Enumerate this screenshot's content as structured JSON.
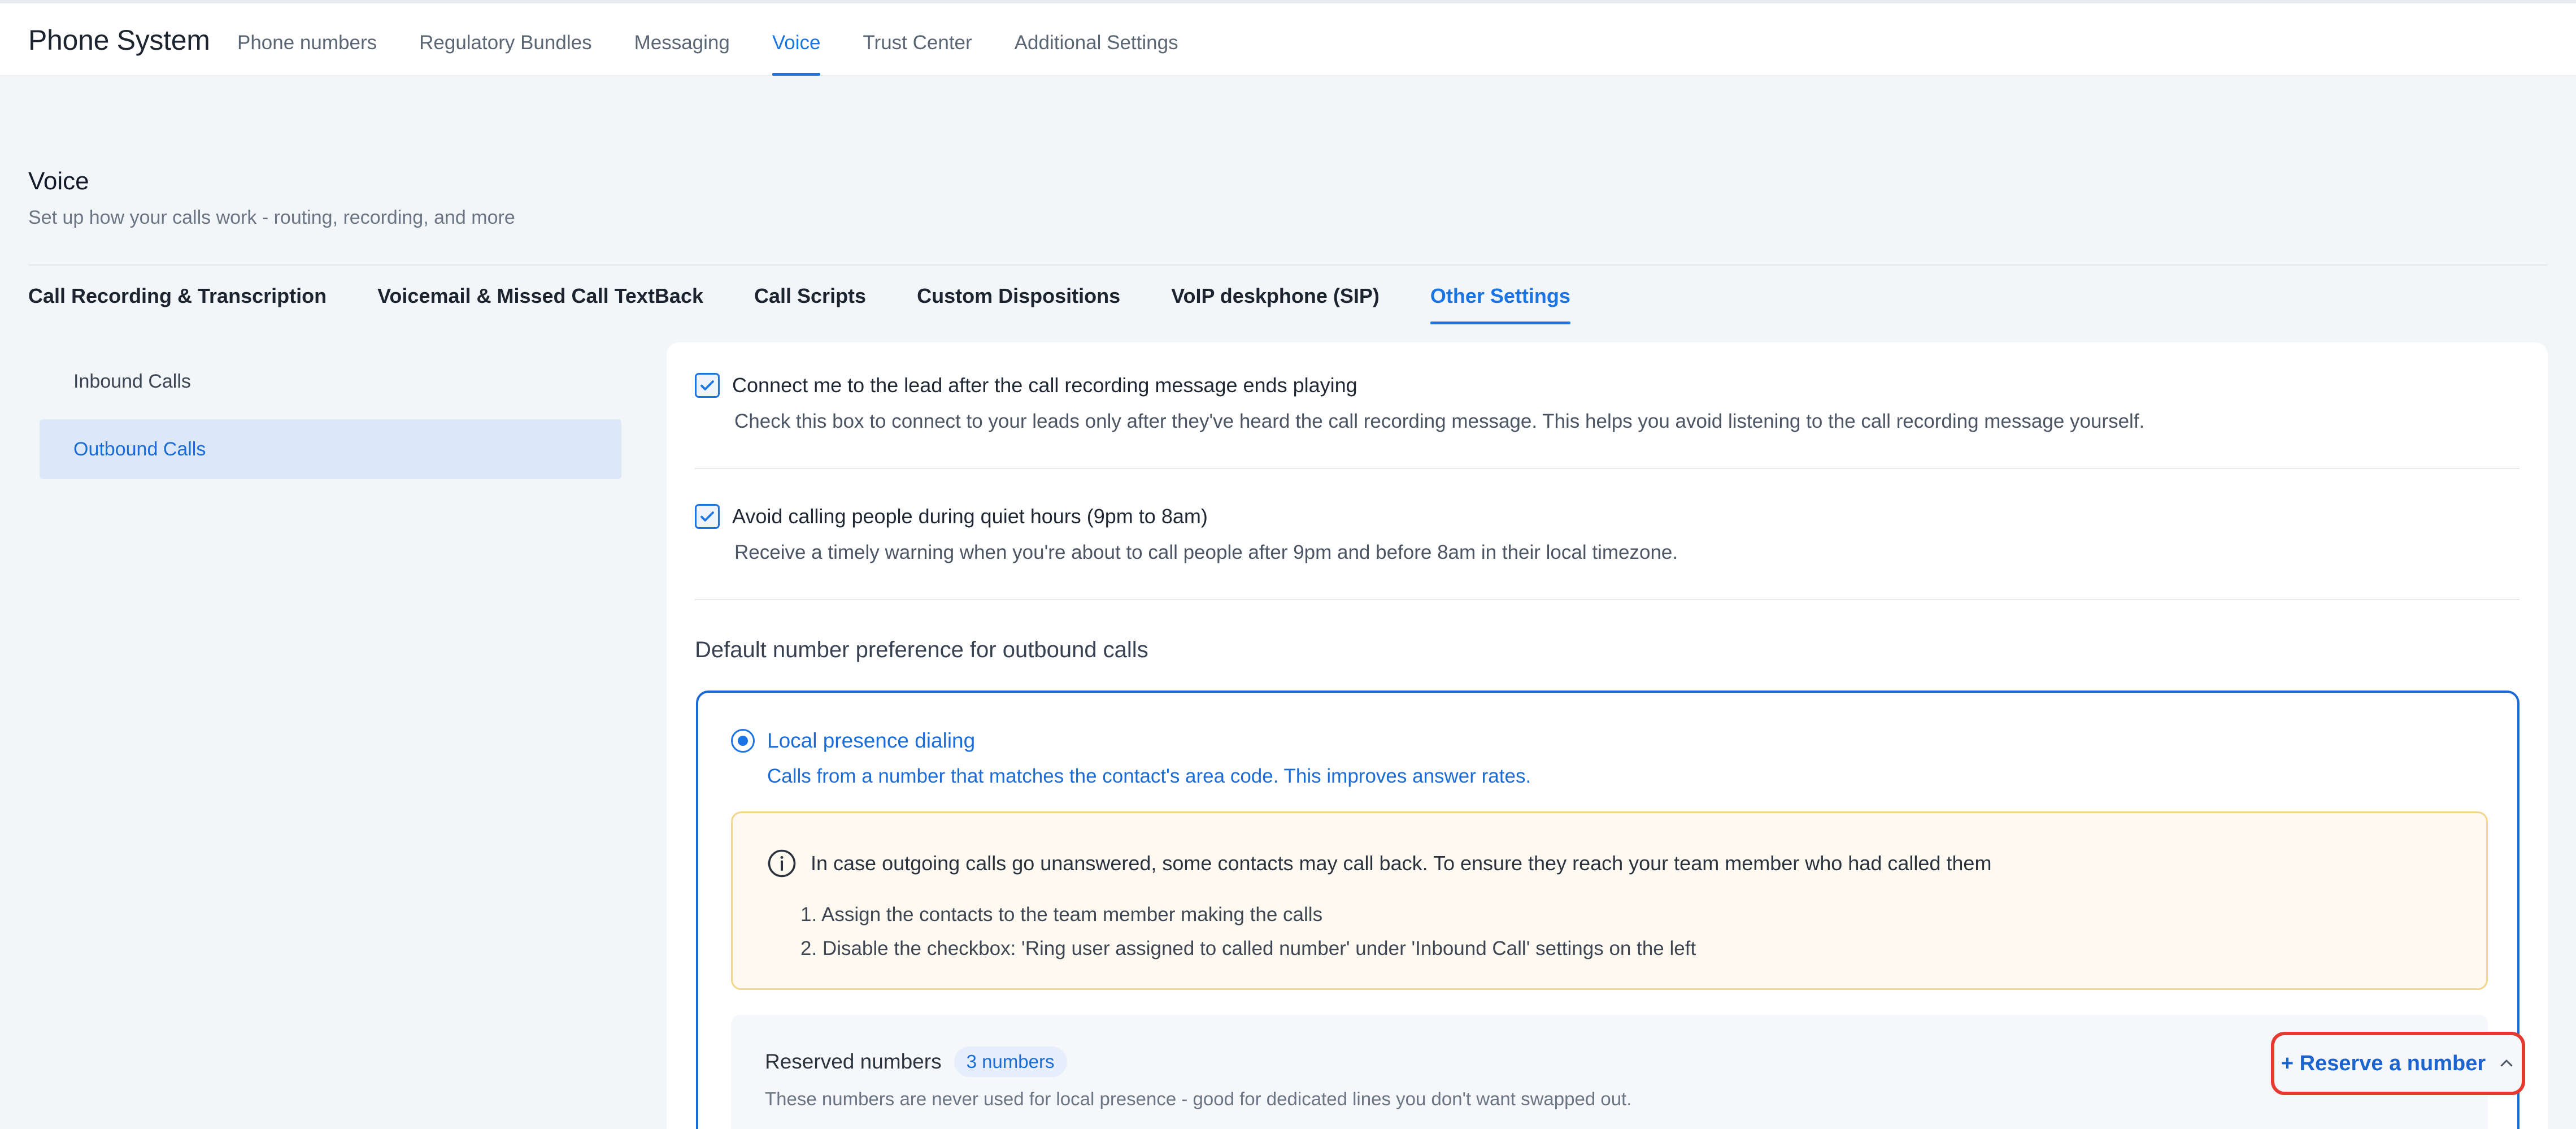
{
  "app": {
    "title": "Phone System",
    "nav": [
      {
        "label": "Phone numbers"
      },
      {
        "label": "Regulatory Bundles"
      },
      {
        "label": "Messaging"
      },
      {
        "label": "Voice"
      },
      {
        "label": "Trust Center"
      },
      {
        "label": "Additional Settings"
      }
    ],
    "active_nav": "Voice"
  },
  "page": {
    "title": "Voice",
    "subtitle": "Set up how your calls work - routing, recording, and more"
  },
  "subtabs": [
    {
      "label": "Call Recording & Transcription"
    },
    {
      "label": "Voicemail & Missed Call TextBack"
    },
    {
      "label": "Call Scripts"
    },
    {
      "label": "Custom Dispositions"
    },
    {
      "label": "VoIP deskphone (SIP)"
    },
    {
      "label": "Other Settings"
    }
  ],
  "active_subtab": "Other Settings",
  "sidebar": {
    "items": [
      {
        "label": "Inbound Calls"
      },
      {
        "label": "Outbound Calls"
      }
    ],
    "active": "Outbound Calls"
  },
  "settings": {
    "connect_after_recording": {
      "checked": true,
      "title": "Connect me to the lead after the call recording message ends playing",
      "description": "Check this box to connect to your leads only after they've heard the call recording message. This helps you avoid listening to the call recording message yourself."
    },
    "quiet_hours": {
      "checked": true,
      "title": "Avoid calling people during quiet hours (9pm to 8am)",
      "description": "Receive a timely warning when you're about to call people after 9pm and before 8am in their local timezone."
    }
  },
  "number_preference": {
    "section_title": "Default number preference for outbound calls",
    "option": {
      "selected": true,
      "label": "Local presence dialing",
      "description": "Calls from a number that matches the contact's area code. This improves answer rates."
    },
    "notice": {
      "text": "In case outgoing calls go unanswered, some contacts may call back. To ensure they reach your team member who had called them",
      "steps": [
        "1. Assign the contacts to the team member making the calls",
        "2. Disable the checkbox: 'Ring user assigned to called number' under 'Inbound Call' settings on the left"
      ]
    },
    "reserved": {
      "title": "Reserved numbers",
      "badge": "3 numbers",
      "description": "These numbers are never used for local presence - good for dedicated lines you don't want swapped out.",
      "button_label": "+ Reserve a number"
    }
  },
  "colors": {
    "accent": "#1b74e4",
    "highlight": "#e53a2f",
    "notice_bg": "#fffaf1",
    "notice_border": "#f3d58b"
  }
}
